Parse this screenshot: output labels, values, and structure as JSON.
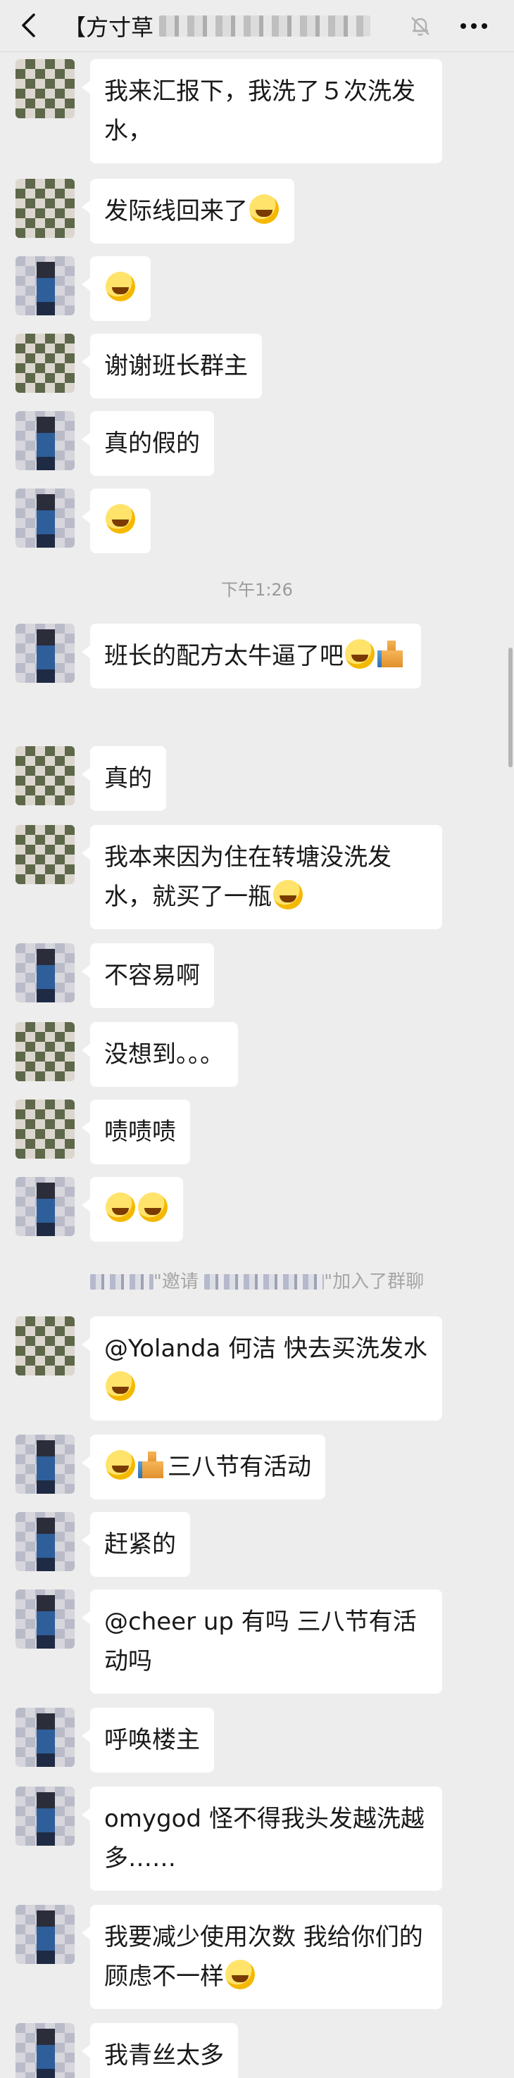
{
  "header": {
    "title": "【方寸草",
    "back_icon": "chevron-left-icon",
    "mute_icon": "bell-off-icon",
    "more_icon": "more-dots-icon"
  },
  "messages": [
    {
      "text": "我来汇报下，我洗了５次洗发水，",
      "emoji": ""
    },
    {
      "text": "发际线回来了",
      "emoji": "grin"
    },
    {
      "text": "",
      "emoji": "laugh-cry"
    },
    {
      "text": "谢谢班长群主",
      "emoji": ""
    },
    {
      "text": "真的假的",
      "emoji": ""
    },
    {
      "text": "",
      "emoji": "smirk"
    },
    {
      "text": "班长的配方太牛逼了吧",
      "emoji": "laugh-cry-thumb"
    },
    {
      "text": "真的",
      "emoji": ""
    },
    {
      "text": "我本来因为住在转塘没洗发水，就买了一瓶",
      "emoji": "laugh-cry"
    },
    {
      "text": "不容易啊",
      "emoji": ""
    },
    {
      "text": "没想到。。。",
      "emoji": ""
    },
    {
      "text": "啧啧啧",
      "emoji": ""
    },
    {
      "text": "",
      "emoji": "smirk-smirk"
    },
    {
      "text": "@Yolanda 何洁  快去买洗发水",
      "emoji": "grin"
    },
    {
      "text": "三八节有活动",
      "emoji": "laugh-cry-thumb-prefix"
    },
    {
      "text": "赶紧的",
      "emoji": ""
    },
    {
      "text": "@cheer up  有吗 三八节有活动吗",
      "emoji": ""
    },
    {
      "text": "呼唤楼主",
      "emoji": ""
    },
    {
      "text": "omygod 怪不得我头发越洗越多……",
      "emoji": ""
    },
    {
      "text": "我要减少使用次数 我给你们的顾虑不一样",
      "emoji": "laugh-cry"
    },
    {
      "text": "我青丝太多",
      "emoji": ""
    }
  ],
  "timestamp": "下午1:26",
  "system_note": {
    "invite": "\"邀请",
    "joined": "\"加入了群聊"
  }
}
